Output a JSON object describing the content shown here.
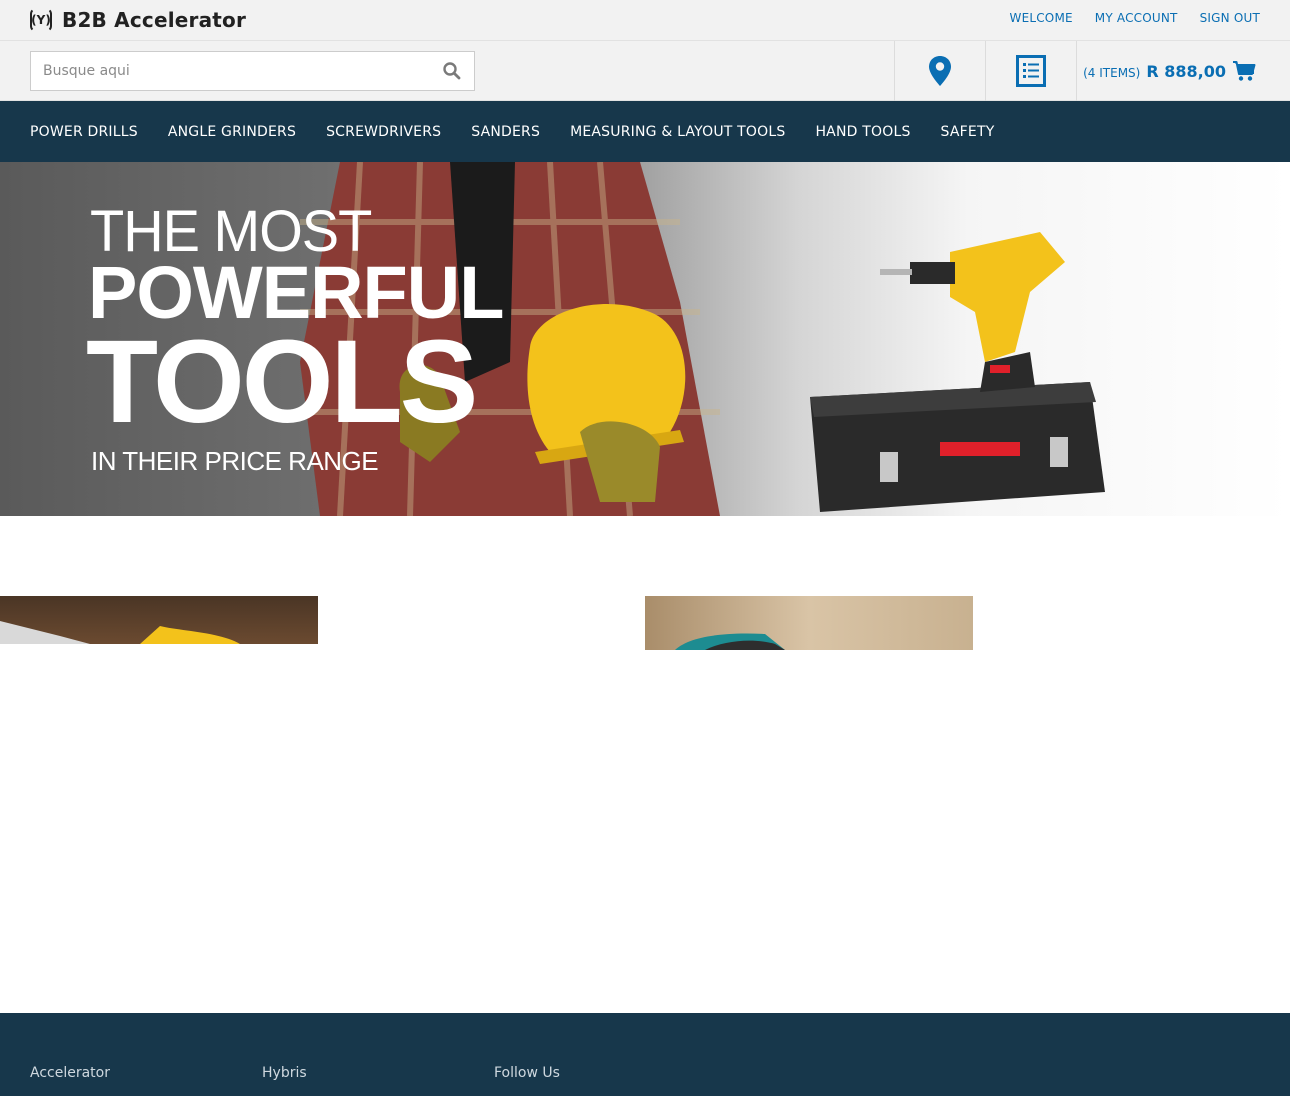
{
  "header": {
    "logo_mark": "(Y)",
    "logo_text": "B2B Accelerator",
    "links": [
      "WELCOME",
      "MY ACCOUNT",
      "SIGN OUT"
    ]
  },
  "search": {
    "placeholder": "Busque aqui",
    "value": ""
  },
  "cart": {
    "count_label": "(4 ITEMS)",
    "total": "R 888,00"
  },
  "nav": {
    "items": [
      "POWER DRILLS",
      "ANGLE GRINDERS",
      "SCREWDRIVERS",
      "SANDERS",
      "MEASURING & LAYOUT TOOLS",
      "HAND TOOLS",
      "SAFETY"
    ]
  },
  "hero": {
    "line1": "THE MOST",
    "line2": "POWERFUL",
    "line3": "TOOLS",
    "line4": "IN THEIR PRICE RANGE"
  },
  "footer": {
    "columns": [
      "Accelerator",
      "Hybris",
      "Follow Us"
    ]
  },
  "colors": {
    "accent": "#0a6eb3",
    "nav_bg": "#17374b",
    "tool_yellow": "#f3c21b"
  },
  "icons": [
    "search-icon",
    "store-locator-icon",
    "quick-order-list-icon",
    "cart-icon"
  ]
}
